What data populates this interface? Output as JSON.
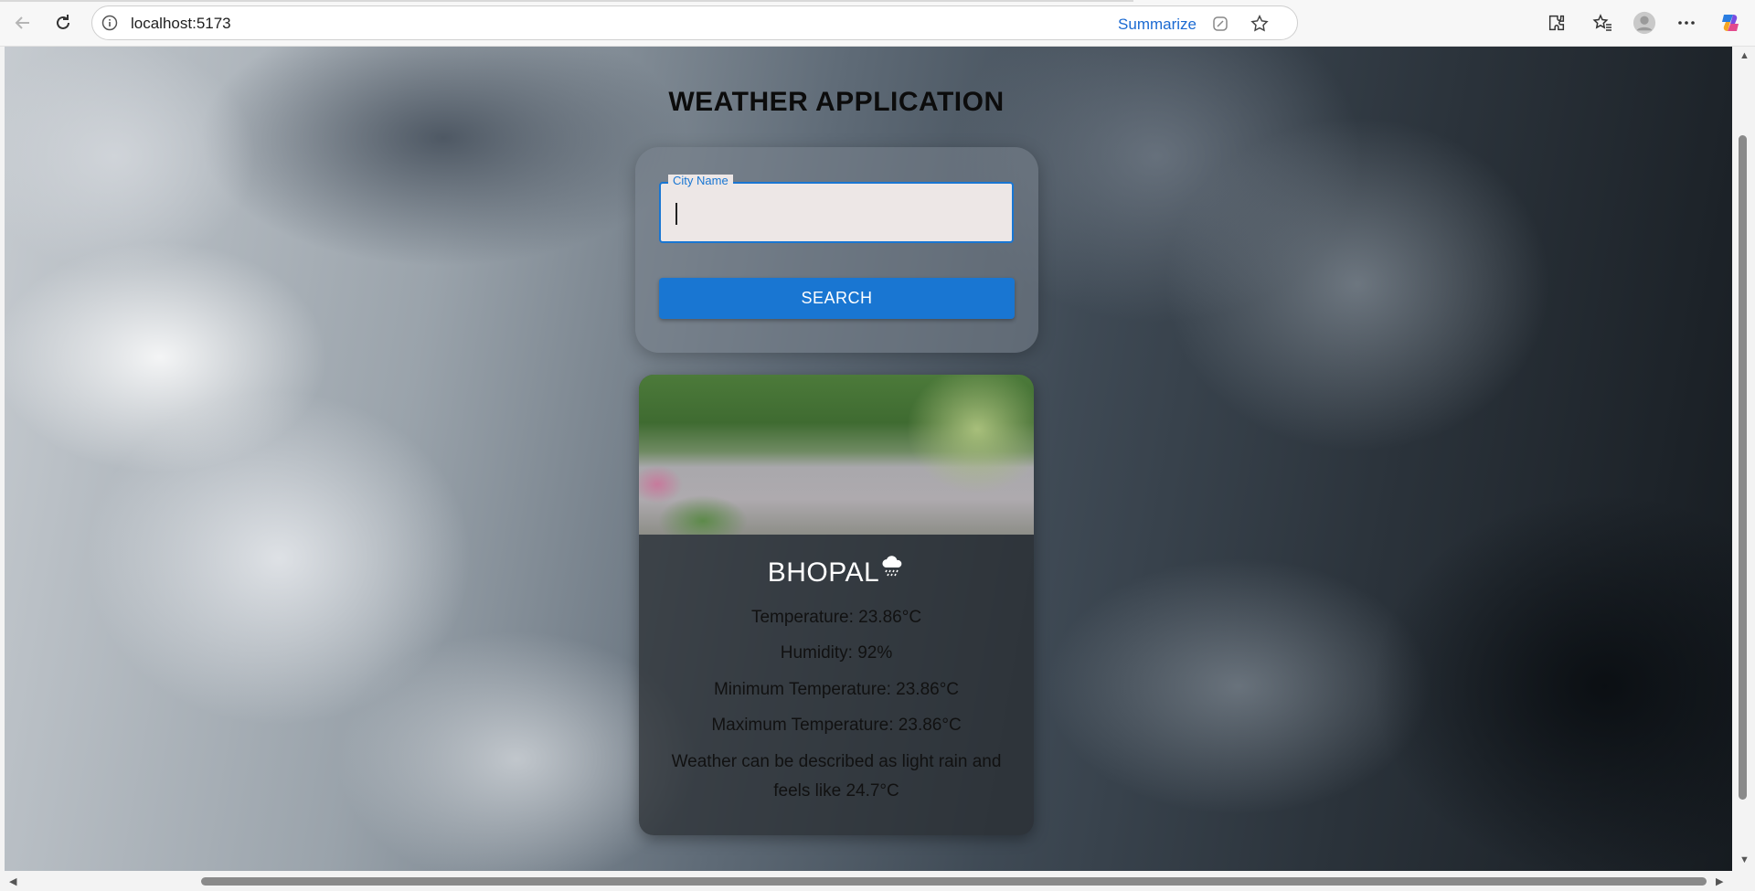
{
  "browser": {
    "url": "localhost:5173",
    "summarize_label": "Summarize"
  },
  "page": {
    "title": "WEATHER APPLICATION"
  },
  "search": {
    "label": "City Name",
    "value": "",
    "button_label": "SEARCH"
  },
  "weather": {
    "city": "BHOPAL",
    "icon": "rain-cloud-icon",
    "temperature": "Temperature: 23.86°C",
    "humidity": "Humidity: 92%",
    "min_temperature": "Minimum Temperature: 23.86°C",
    "max_temperature": "Maximum Temperature: 23.86°C",
    "description": "Weather can be described as light rain and feels like 24.7°C"
  },
  "colors": {
    "accent": "#1976d2",
    "link": "#1b6ad2"
  }
}
